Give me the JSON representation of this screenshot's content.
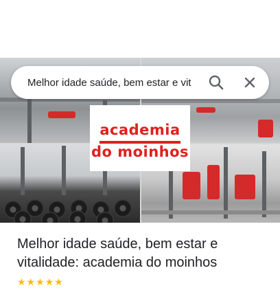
{
  "search": {
    "query": "Melhor idade saúde, bem estar e vit",
    "search_icon": "search-icon",
    "close_icon": "close-icon"
  },
  "logo": {
    "line1": "academia",
    "line2": "do moinhos"
  },
  "result": {
    "title": "Melhor idade saúde, bem estar e vitalidade: academia do moinhos",
    "stars": "★★★★★"
  },
  "colors": {
    "brand_red": "#e0201e",
    "text": "#202124"
  }
}
